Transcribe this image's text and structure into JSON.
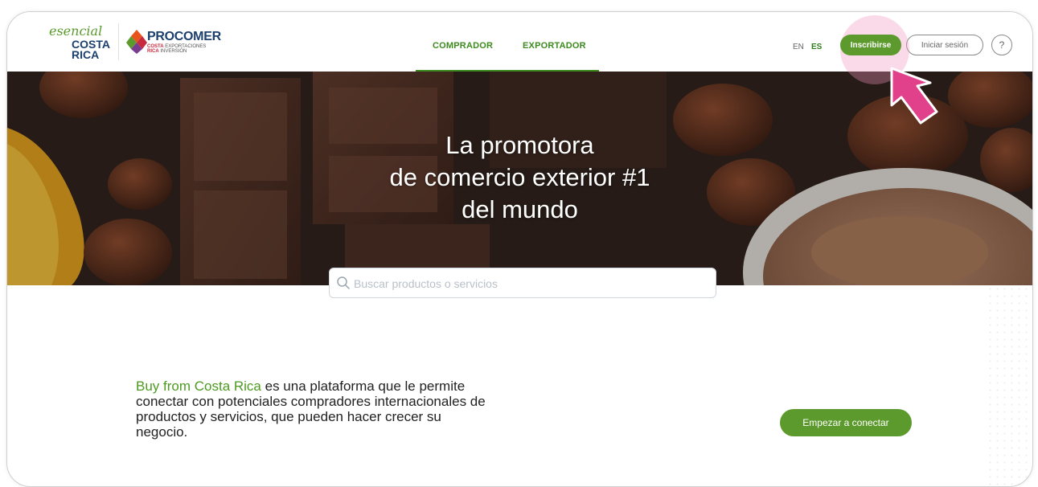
{
  "header": {
    "esencial_logo": {
      "script": "esencial",
      "line1": "COSTA",
      "line2": "RICA"
    },
    "procomer_logo": {
      "name": "PROCOMER",
      "sub1": "COSTA",
      "sub2": "EXPORTACIONES",
      "sub3": "RICA",
      "sub4": "INVERSIÓN"
    },
    "nav": [
      {
        "label": "COMPRADOR"
      },
      {
        "label": "EXPORTADOR"
      }
    ],
    "languages": [
      "EN",
      "ES"
    ],
    "active_language": "ES",
    "signup_label": "Inscribirse",
    "login_label": "Iniciar sesión",
    "help_label": "?"
  },
  "hero": {
    "title_line1": "La promotora",
    "title_line2": "de comercio exterior #1",
    "title_line3": "del mundo"
  },
  "search": {
    "placeholder": "Buscar productos o servicios",
    "icon": "search-icon"
  },
  "intro": {
    "accent": "Buy from Costa Rica",
    "text": " es una plataforma que le permite conectar con potenciales compradores internacionales de productos y servicios, que pueden hacer crecer su negocio.",
    "cta_label": "Empezar a conectar"
  },
  "colors": {
    "brand_green": "#5c9a2d",
    "nav_green": "#3d8b1f",
    "highlight_pink": "#e0418a",
    "brand_navy": "#1b3f6e"
  }
}
